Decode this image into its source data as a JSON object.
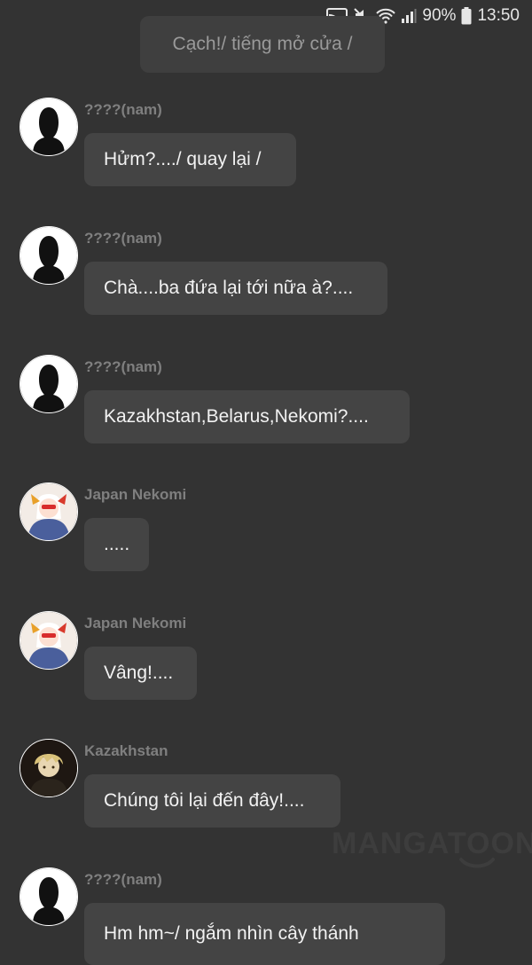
{
  "status_bar": {
    "battery": "90%",
    "time": "13:50",
    "icons": [
      "cast-icon",
      "mute-icon",
      "wifi-icon",
      "signal-icon",
      "battery-icon"
    ]
  },
  "system_message": "Cạch!/ tiếng mở cửa /",
  "messages": [
    {
      "sender": "????(nam)",
      "text": "Hửm?..../ quay lại /",
      "avatar": "silhouette-avatar"
    },
    {
      "sender": "????(nam)",
      "text": "Chà....ba đứa lại tới nữa à?....",
      "avatar": "silhouette-avatar"
    },
    {
      "sender": "????(nam)",
      "text": "Kazakhstan,Belarus,Nekomi?....",
      "avatar": "silhouette-avatar"
    },
    {
      "sender": "Japan Nekomi",
      "text": ".....",
      "avatar": "anime-girl-avatar"
    },
    {
      "sender": "Japan Nekomi",
      "text": "Vâng!....",
      "avatar": "anime-girl-avatar"
    },
    {
      "sender": "Kazakhstan",
      "text": "Chúng tôi lại đến đây!....",
      "avatar": "anime-boy-avatar"
    },
    {
      "sender": "????(nam)",
      "text": "Hm hm~/ ngắm nhìn cây thánh",
      "avatar": "silhouette-avatar"
    }
  ],
  "watermark": "MANGATOON"
}
